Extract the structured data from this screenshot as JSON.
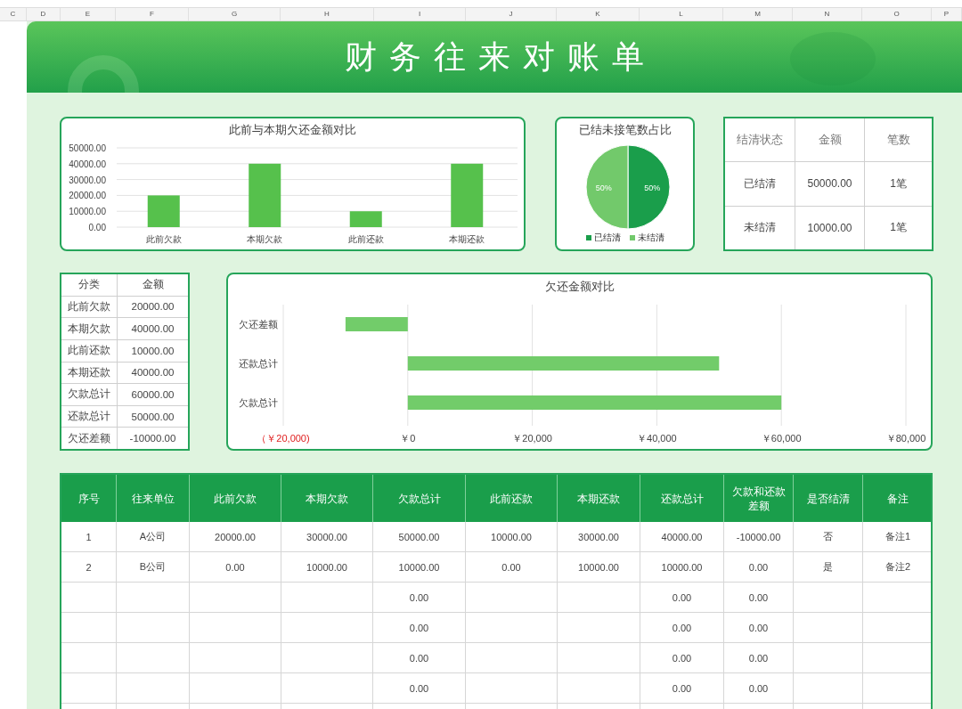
{
  "column_headers": [
    "C",
    "D",
    "E",
    "F",
    "G",
    "H",
    "I",
    "J",
    "K",
    "L",
    "M",
    "N",
    "O",
    "P"
  ],
  "title": "财务往来对账单",
  "debt_chart": {
    "chart_data": {
      "type": "bar",
      "title": "此前与本期欠还金额对比",
      "categories": [
        "此前欠款",
        "本期欠款",
        "此前还款",
        "本期还款"
      ],
      "values": [
        20000,
        40000,
        10000,
        40000
      ],
      "ylim": [
        0,
        50000
      ],
      "yticks": [
        {
          "value": 0,
          "label": "0.00"
        },
        {
          "value": 10000,
          "label": "10000.00"
        },
        {
          "value": 20000,
          "label": "20000.00"
        },
        {
          "value": 30000,
          "label": "30000.00"
        },
        {
          "value": 40000,
          "label": "40000.00"
        },
        {
          "value": 50000,
          "label": "50000.00"
        }
      ],
      "grid": true
    }
  },
  "settle_chart": {
    "chart_data": {
      "type": "pie",
      "title": "已结未接笔数占比",
      "categories": [
        "已结清",
        "未结清"
      ],
      "values": [
        50,
        50
      ],
      "value_labels": [
        "50%",
        "50%"
      ],
      "legend": "bottom"
    }
  },
  "status_table": {
    "columns": [
      "结清状态",
      "金额",
      "笔数"
    ],
    "rows": [
      [
        "已结清",
        "50000.00",
        "1笔"
      ],
      [
        "未结清",
        "10000.00",
        "1笔"
      ]
    ]
  },
  "summary_table": {
    "columns": [
      "分类",
      "金额"
    ],
    "rows": [
      [
        "此前欠款",
        "20000.00"
      ],
      [
        "本期欠款",
        "40000.00"
      ],
      [
        "此前还款",
        "10000.00"
      ],
      [
        "本期还款",
        "40000.00"
      ],
      [
        "欠款总计",
        "60000.00"
      ],
      [
        "还款总计",
        "50000.00"
      ],
      [
        "欠还差额",
        "-10000.00"
      ]
    ]
  },
  "balance_chart": {
    "chart_data": {
      "type": "bar",
      "orientation": "horizontal",
      "title": "欠还金额对比",
      "categories": [
        "欠还差额",
        "还款总计",
        "欠款总计"
      ],
      "values": [
        -10000,
        50000,
        60000
      ],
      "xlim": [
        -20000,
        80000
      ],
      "xticks": [
        {
          "value": -20000,
          "label": "（￥20,000)"
        },
        {
          "value": 0,
          "label": "￥0"
        },
        {
          "value": 20000,
          "label": "￥20,000"
        },
        {
          "value": 40000,
          "label": "￥40,000"
        },
        {
          "value": 60000,
          "label": "￥60,000"
        },
        {
          "value": 80000,
          "label": "￥80,000"
        }
      ],
      "grid": true
    }
  },
  "ledger": {
    "columns": [
      "序号",
      "往来单位",
      "此前欠款",
      "本期欠款",
      "欠款总计",
      "此前还款",
      "本期还款",
      "还款总计",
      "欠款和还款差额",
      "是否结清",
      "备注"
    ],
    "rows": [
      [
        "1",
        "A公司",
        "20000.00",
        "30000.00",
        "50000.00",
        "10000.00",
        "30000.00",
        "40000.00",
        "-10000.00",
        "否",
        "备注1"
      ],
      [
        "2",
        "B公司",
        "0.00",
        "10000.00",
        "10000.00",
        "0.00",
        "10000.00",
        "10000.00",
        "0.00",
        "是",
        "备注2"
      ],
      [
        null,
        null,
        null,
        null,
        "0.00",
        null,
        null,
        "0.00",
        "0.00",
        null,
        null
      ],
      [
        null,
        null,
        null,
        null,
        "0.00",
        null,
        null,
        "0.00",
        "0.00",
        null,
        null
      ],
      [
        null,
        null,
        null,
        null,
        "0.00",
        null,
        null,
        "0.00",
        "0.00",
        null,
        null
      ],
      [
        null,
        null,
        null,
        null,
        "0.00",
        null,
        null,
        "0.00",
        "0.00",
        null,
        null
      ]
    ]
  }
}
